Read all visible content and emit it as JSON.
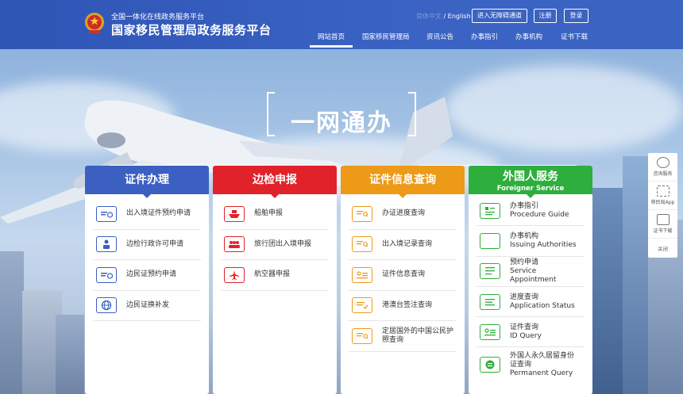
{
  "header": {
    "sub_title": "全国一体化在线政务服务平台",
    "main_title": "国家移民管理局政务服务平台",
    "lang_cn": "简体中文",
    "lang_sep": " / ",
    "lang_en": "English",
    "accessible_btn": "进入无障碍通道",
    "register_btn": "注册",
    "login_btn": "登录",
    "nav": [
      "网站首页",
      "国家移民管理局",
      "资讯公告",
      "办事指引",
      "办事机构",
      "证书下载"
    ]
  },
  "banner": {
    "title": "一网通办"
  },
  "cards": [
    {
      "title": "证件办理",
      "color": "#3c5fc2",
      "items": [
        {
          "label": "出入境证件预约申请",
          "icon": "id-card-clock-icon"
        },
        {
          "label": "边检行政许可申请",
          "icon": "person-document-icon"
        },
        {
          "label": "边民证预约申请",
          "icon": "id-card-clock-icon"
        },
        {
          "label": "边民证换补发",
          "icon": "globe-icon"
        }
      ]
    },
    {
      "title": "边检申报",
      "color": "#e2222a",
      "items": [
        {
          "label": "船舶申报",
          "icon": "ship-icon"
        },
        {
          "label": "旅行团出入境申报",
          "icon": "group-icon"
        },
        {
          "label": "航空器申报",
          "icon": "airplane-icon"
        }
      ]
    },
    {
      "title": "证件信息查询",
      "color": "#ec9a18",
      "items": [
        {
          "label": "办证进度查询",
          "icon": "document-search-icon"
        },
        {
          "label": "出入境记录查询",
          "icon": "document-search-icon"
        },
        {
          "label": "证件信息查询",
          "icon": "id-card-icon"
        },
        {
          "label": "港澳台签注查询",
          "icon": "document-check-icon"
        },
        {
          "label": "定居国外的中国公民护照查询",
          "icon": "document-search-icon"
        }
      ]
    },
    {
      "title": "外国人服务",
      "subtitle": "Foreigner Service",
      "color": "#2eae3c",
      "items": [
        {
          "label": "办事指引",
          "en": "Procedure Guide",
          "icon": "guide-icon"
        },
        {
          "label": "办事机构",
          "en": "Issuing Authorities",
          "icon": "compass-icon"
        },
        {
          "label": "预约申请",
          "en": "Service Appointment",
          "icon": "form-icon"
        },
        {
          "label": "进度查询",
          "en": "Application Status",
          "icon": "progress-icon"
        },
        {
          "label": "证件查询",
          "en": "ID Query",
          "icon": "id-card-icon"
        },
        {
          "label": "外国人永久居留身份证查询",
          "en": "Permanent Query",
          "icon": "permanent-id-icon"
        }
      ]
    }
  ],
  "side_tools": {
    "items": [
      "咨询服务",
      "移民局App",
      "证书下载"
    ],
    "close": "关闭"
  }
}
